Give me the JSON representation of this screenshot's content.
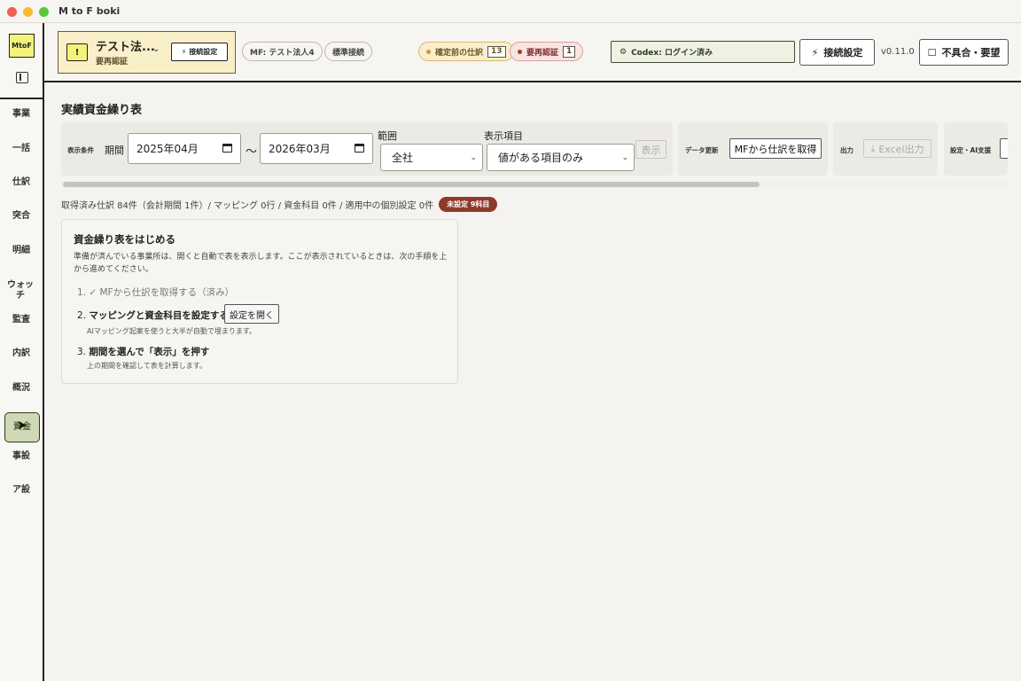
{
  "window": {
    "title": "M to F boki"
  },
  "sidebar": {
    "logo": "MtoF",
    "items": [
      {
        "label": "事業"
      },
      {
        "label": "一括"
      },
      {
        "label": "仕訳"
      },
      {
        "label": "突合"
      },
      {
        "label": "明細"
      },
      {
        "label": "ウォッチ"
      },
      {
        "label": "監査"
      },
      {
        "label": "内訳"
      },
      {
        "label": "概況"
      },
      {
        "label": "資金",
        "active": true
      },
      {
        "label": "事設"
      },
      {
        "label": "ア設"
      }
    ]
  },
  "header": {
    "company_name": "テスト法...",
    "company_status": "要再認証",
    "company_connect_label": "接続設定",
    "mf_pill": "MF: テスト法人4",
    "standard_pill": "標準接続",
    "status_unconfirmed": {
      "label": "確定前の仕訳",
      "count": "13",
      "color": "#c79a2c"
    },
    "status_reauth": {
      "label": "要再認証",
      "count": "1",
      "color": "#a33a2c"
    },
    "codex_status": "Codex: ログイン済み",
    "connect_settings": "接続設定",
    "version": "v0.11.0",
    "feedback": "不具合・要望"
  },
  "main": {
    "title": "実績資金繰り表",
    "display_conditions": {
      "group_label": "表示条件",
      "period_label": "期間",
      "period_start": "2025年04月",
      "tilde": "〜",
      "period_end": "2026年03月",
      "range_label": "範囲",
      "range_value": "全社",
      "items_label": "表示項目",
      "items_value": "値がある項目のみ",
      "show_button": "表示"
    },
    "data_update": {
      "group_label": "データ更新",
      "fetch_button": "MFから仕訳を取得"
    },
    "output": {
      "group_label": "出力",
      "excel_button": "Excel出力"
    },
    "settings_ai": {
      "group_label": "設定・AI支援"
    },
    "stats_text": "取得済み仕訳 84件（会計期間 1件）/ マッピング 0行 / 資金科目 0件 / 適用中の個別設定 0件",
    "unset_badge": "未設定 9科目",
    "guide": {
      "title": "資金繰り表をはじめる",
      "description": "準備が済んでいる事業所は、開くと自動で表を表示します。ここが表示されているときは、次の手順を上から進めてください。",
      "step1": "1. ✓ MFから仕訳を取得する（済み）",
      "step2_num": "2.",
      "step2": "マッピングと資金科目を設定する",
      "step2_button": "設定を開く",
      "step2_sub": "AIマッピング起案を使うと大半が自動で埋まります。",
      "step3_num": "3.",
      "step3": "期間を選んで「表示」を押す",
      "step3_sub": "上の期間を確認して表を計算します。"
    }
  }
}
